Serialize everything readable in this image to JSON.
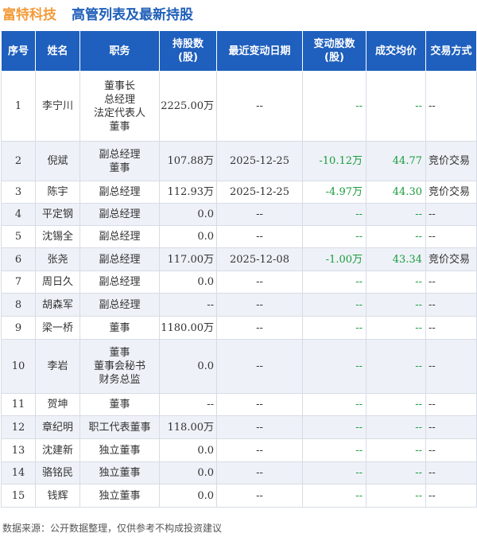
{
  "header": {
    "company": "富特科技",
    "title": "高管列表及最新持股"
  },
  "columns": [
    "序号",
    "姓名",
    "职务",
    "持股数\n(股)",
    "最近变动日期",
    "变动股数\n(股)",
    "成交均价",
    "交易方式"
  ],
  "rows": [
    {
      "no": "1",
      "name": "李宁川",
      "positions": [
        "董事长",
        "总经理",
        "法定代表人",
        "董事"
      ],
      "holding": "2225.00万",
      "date": "--",
      "change": "--",
      "price": "--",
      "mode": "--"
    },
    {
      "no": "2",
      "name": "倪斌",
      "positions": [
        "副总经理",
        "董事"
      ],
      "holding": "107.88万",
      "date": "2025-12-25",
      "change": "-10.12万",
      "price": "44.77",
      "mode": "竞价交易"
    },
    {
      "no": "3",
      "name": "陈宇",
      "positions": [
        "副总经理"
      ],
      "holding": "112.93万",
      "date": "2025-12-25",
      "change": "-4.97万",
      "price": "44.30",
      "mode": "竞价交易"
    },
    {
      "no": "4",
      "name": "平定钢",
      "positions": [
        "副总经理"
      ],
      "holding": "0.0",
      "date": "--",
      "change": "--",
      "price": "--",
      "mode": "--"
    },
    {
      "no": "5",
      "name": "沈锡全",
      "positions": [
        "副总经理"
      ],
      "holding": "0.0",
      "date": "--",
      "change": "--",
      "price": "--",
      "mode": "--"
    },
    {
      "no": "6",
      "name": "张尧",
      "positions": [
        "副总经理"
      ],
      "holding": "117.00万",
      "date": "2025-12-08",
      "change": "-1.00万",
      "price": "43.34",
      "mode": "竞价交易"
    },
    {
      "no": "7",
      "name": "周日久",
      "positions": [
        "副总经理"
      ],
      "holding": "0.0",
      "date": "--",
      "change": "--",
      "price": "--",
      "mode": "--"
    },
    {
      "no": "8",
      "name": "胡森军",
      "positions": [
        "副总经理"
      ],
      "holding": "--",
      "date": "--",
      "change": "--",
      "price": "--",
      "mode": "--"
    },
    {
      "no": "9",
      "name": "梁一桥",
      "positions": [
        "董事"
      ],
      "holding": "1180.00万",
      "date": "--",
      "change": "--",
      "price": "--",
      "mode": "--"
    },
    {
      "no": "10",
      "name": "李岩",
      "positions": [
        "董事",
        "董事会秘书",
        "财务总监"
      ],
      "holding": "0.0",
      "date": "--",
      "change": "--",
      "price": "--",
      "mode": "--"
    },
    {
      "no": "11",
      "name": "贺坤",
      "positions": [
        "董事"
      ],
      "holding": "--",
      "date": "--",
      "change": "--",
      "price": "--",
      "mode": "--"
    },
    {
      "no": "12",
      "name": "章纪明",
      "positions": [
        "职工代表董事"
      ],
      "holding": "118.00万",
      "date": "--",
      "change": "--",
      "price": "--",
      "mode": "--"
    },
    {
      "no": "13",
      "name": "沈建新",
      "positions": [
        "独立董事"
      ],
      "holding": "0.0",
      "date": "--",
      "change": "--",
      "price": "--",
      "mode": "--"
    },
    {
      "no": "14",
      "name": "骆铭民",
      "positions": [
        "独立董事"
      ],
      "holding": "0.0",
      "date": "--",
      "change": "--",
      "price": "--",
      "mode": "--"
    },
    {
      "no": "15",
      "name": "钱辉",
      "positions": [
        "独立董事"
      ],
      "holding": "0.0",
      "date": "--",
      "change": "--",
      "price": "--",
      "mode": "--"
    }
  ],
  "footer": "数据来源：公开数据整理，仅供参考不构成投资建议",
  "colors": {
    "header_bg": "#1f5fbd",
    "company": "#f29b3a",
    "title": "#1f5fb8",
    "negative": "#1a9b3c"
  }
}
